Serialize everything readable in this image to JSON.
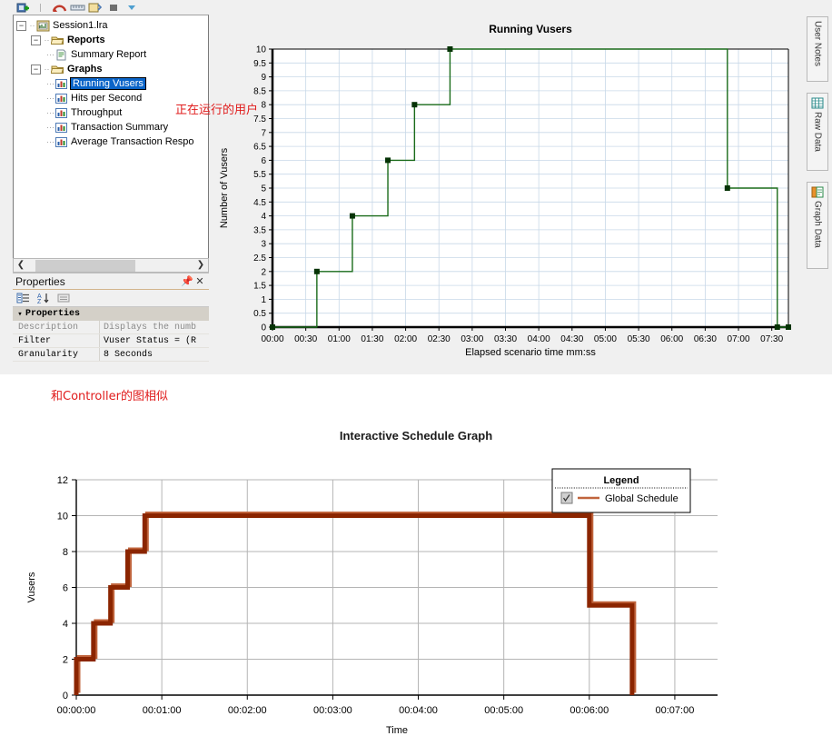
{
  "window": {
    "toolbar_icons": [
      "new-session-icon",
      "separator-icon",
      "undo-icon",
      "ruler-icon",
      "new-graph-icon",
      "stop-icon",
      "chevron-down-icon"
    ]
  },
  "tree": {
    "root": {
      "label": "Session1.lra",
      "icon": "session-file-icon",
      "expanded": true
    },
    "nodes": [
      {
        "label": "Reports",
        "icon": "folder-icon",
        "bold": true,
        "level": 2,
        "expanded": true
      },
      {
        "label": "Summary Report",
        "icon": "report-doc-icon",
        "bold": false,
        "level": 3
      },
      {
        "label": "Graphs",
        "icon": "folder-icon",
        "bold": true,
        "level": 2,
        "expanded": true
      },
      {
        "label": "Running Vusers",
        "icon": "bar-chart-icon",
        "bold": false,
        "level": 3,
        "selected": true
      },
      {
        "label": "Hits per Second",
        "icon": "bar-chart-icon",
        "bold": false,
        "level": 3
      },
      {
        "label": "Throughput",
        "icon": "bar-chart-icon",
        "bold": false,
        "level": 3
      },
      {
        "label": "Transaction Summary",
        "icon": "bar-chart-icon",
        "bold": false,
        "level": 3
      },
      {
        "label": "Average Transaction Respo",
        "icon": "bar-chart-icon",
        "bold": false,
        "level": 3
      }
    ]
  },
  "properties": {
    "title": "Properties",
    "pin_icon": "pin-icon",
    "close_icon": "close-icon",
    "toolbar_icons": [
      "categorized-icon",
      "alphabetical-icon",
      "property-pages-icon"
    ],
    "category": "Properties",
    "rows": [
      {
        "key": "Description",
        "value": "Displays the numb",
        "dim": true
      },
      {
        "key": "Filter",
        "value": "Vuser Status = (R",
        "dim": false
      },
      {
        "key": "Granularity",
        "value": "8 Seconds",
        "dim": false
      }
    ]
  },
  "right_tabs": [
    {
      "label": "User Notes",
      "icon": "notes-icon"
    },
    {
      "label": "Raw Data",
      "icon": "raw-data-icon"
    },
    {
      "label": "Graph Data",
      "icon": "graph-data-icon"
    }
  ],
  "annotations": [
    {
      "id": "note-1",
      "text": "正在运行的用户",
      "color": "#e01b1b"
    },
    {
      "id": "note-2",
      "text": "和Controller的图相似",
      "color": "#e01b1b"
    }
  ],
  "colors": {
    "running_vusers_line": "#1a6b1a",
    "schedule_line_dark": "#8b2500",
    "schedule_line_light": "#c0643c",
    "grid": "#c8d8e8",
    "selection": "#0a64c8",
    "annotation": "#e01b1b"
  },
  "chart_data": [
    {
      "id": "running-vusers",
      "type": "line",
      "title": "Running Vusers",
      "xlabel": "Elapsed scenario time mm:ss",
      "ylabel": "Number of Vusers",
      "ylim": [
        0,
        10
      ],
      "ytick_step": 0.5,
      "yticks": [
        "0",
        "0.5",
        "1",
        "1.5",
        "2",
        "2.5",
        "3",
        "3.5",
        "4",
        "4.5",
        "5",
        "5.5",
        "6",
        "6.5",
        "7",
        "7.5",
        "8",
        "8.5",
        "9",
        "9.5",
        "10"
      ],
      "xticks": [
        "00:00",
        "00:30",
        "01:00",
        "01:30",
        "02:00",
        "02:30",
        "03:00",
        "03:30",
        "04:00",
        "04:30",
        "05:00",
        "05:30",
        "06:00",
        "06:30",
        "07:00",
        "07:30"
      ],
      "xlim_seconds": [
        0,
        465
      ],
      "grid": true,
      "legend": "none",
      "series": [
        {
          "name": "Running Vusers",
          "color": "#1a6b1a",
          "step": "post",
          "markers": true,
          "points": [
            {
              "t": 0,
              "v": 0
            },
            {
              "t": 40,
              "v": 0
            },
            {
              "t": 40,
              "v": 2
            },
            {
              "t": 72,
              "v": 2
            },
            {
              "t": 72,
              "v": 4
            },
            {
              "t": 104,
              "v": 4
            },
            {
              "t": 104,
              "v": 6
            },
            {
              "t": 128,
              "v": 6
            },
            {
              "t": 128,
              "v": 8
            },
            {
              "t": 160,
              "v": 8
            },
            {
              "t": 160,
              "v": 10
            },
            {
              "t": 410,
              "v": 10
            },
            {
              "t": 410,
              "v": 5
            },
            {
              "t": 455,
              "v": 5
            },
            {
              "t": 455,
              "v": 0
            },
            {
              "t": 465,
              "v": 0
            }
          ]
        }
      ]
    },
    {
      "id": "interactive-schedule",
      "type": "line",
      "title": "Interactive Schedule Graph",
      "xlabel": "Time",
      "ylabel": "Vusers",
      "ylim": [
        0,
        12
      ],
      "ytick_step": 2,
      "yticks": [
        "0",
        "2",
        "4",
        "6",
        "8",
        "10",
        "12"
      ],
      "xticks": [
        "00:00:00",
        "00:01:00",
        "00:02:00",
        "00:03:00",
        "00:04:00",
        "00:05:00",
        "00:06:00",
        "00:07:00"
      ],
      "xlim_seconds": [
        0,
        450
      ],
      "grid": true,
      "legend": {
        "position": "top-right",
        "title": "Legend",
        "checkbox_checked": true
      },
      "series": [
        {
          "name": "Global Schedule",
          "color": "#8b2500",
          "step": "post",
          "markers": false,
          "points": [
            {
              "t": 0,
              "v": 0
            },
            {
              "t": 0,
              "v": 2
            },
            {
              "t": 12,
              "v": 2
            },
            {
              "t": 12,
              "v": 4
            },
            {
              "t": 24,
              "v": 4
            },
            {
              "t": 24,
              "v": 6
            },
            {
              "t": 36,
              "v": 6
            },
            {
              "t": 36,
              "v": 8
            },
            {
              "t": 48,
              "v": 8
            },
            {
              "t": 48,
              "v": 10
            },
            {
              "t": 360,
              "v": 10
            },
            {
              "t": 360,
              "v": 5
            },
            {
              "t": 390,
              "v": 5
            },
            {
              "t": 390,
              "v": 0
            }
          ]
        }
      ]
    }
  ]
}
